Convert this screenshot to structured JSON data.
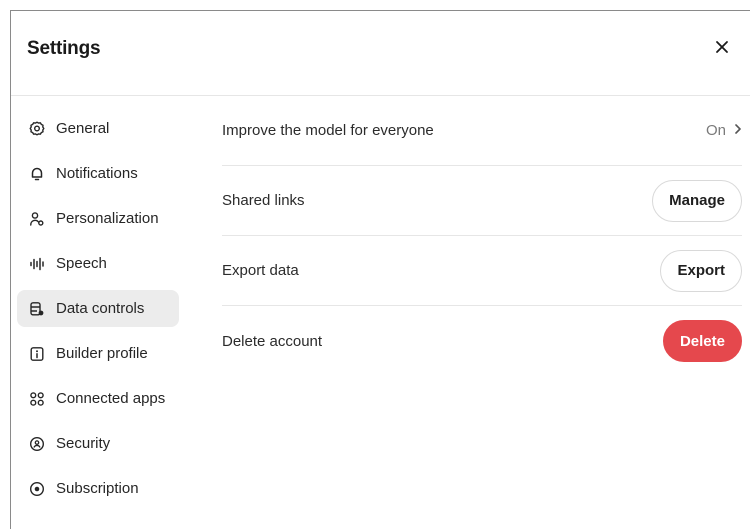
{
  "dialog": {
    "title": "Settings",
    "close_icon": "close-icon"
  },
  "sidebar": {
    "items": [
      {
        "label": "General",
        "icon": "gear-icon",
        "active": false
      },
      {
        "label": "Notifications",
        "icon": "bell-icon",
        "active": false
      },
      {
        "label": "Personalization",
        "icon": "person-icon",
        "active": false
      },
      {
        "label": "Speech",
        "icon": "waveform-icon",
        "active": false
      },
      {
        "label": "Data controls",
        "icon": "database-icon",
        "active": true
      },
      {
        "label": "Builder profile",
        "icon": "id-card-icon",
        "active": false
      },
      {
        "label": "Connected apps",
        "icon": "apps-grid-icon",
        "active": false
      },
      {
        "label": "Security",
        "icon": "shield-icon",
        "active": false
      },
      {
        "label": "Subscription",
        "icon": "subscription-icon",
        "active": false
      }
    ]
  },
  "main": {
    "rows": [
      {
        "label": "Improve the model for everyone",
        "value": "On"
      },
      {
        "label": "Shared links",
        "button": "Manage"
      },
      {
        "label": "Export data",
        "button": "Export"
      },
      {
        "label": "Delete account",
        "button": "Delete"
      }
    ]
  },
  "colors": {
    "active_bg": "#ececec",
    "danger": "#e5484d",
    "divider": "#e6e6e6",
    "muted_text": "#7a7a7a"
  }
}
